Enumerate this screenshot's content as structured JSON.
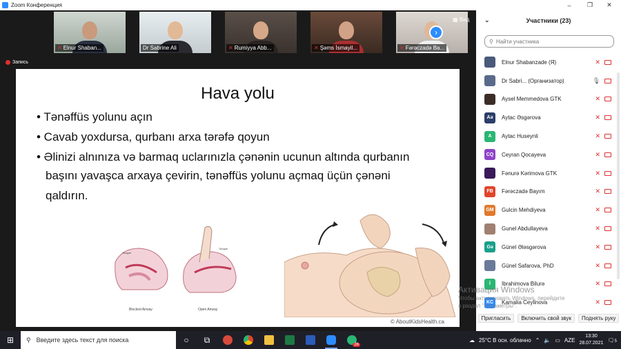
{
  "window": {
    "title": "Zoom Конференция",
    "controls": [
      "–",
      "❐",
      "✕"
    ]
  },
  "gallery": {
    "thumbnails": [
      {
        "name": "Elnur Shaban...",
        "muted": true,
        "active": false
      },
      {
        "name": "Dr Sabrine Ali",
        "muted": false,
        "active": true
      },
      {
        "name": "Rumiyya Abb...",
        "muted": true,
        "active": false
      },
      {
        "name": "Şəms İsmayil...",
        "muted": true,
        "active": false
      },
      {
        "name": "Fərəczadə Ba...",
        "muted": true,
        "active": false
      }
    ],
    "view_label": "Вид",
    "recording_label": "Запись"
  },
  "slide": {
    "title": "Hava yolu",
    "bullets": [
      "• Tənəffüs yolunu açın",
      "• Cavab yoxdursa, qurbanı arxa tərəfə qoyun",
      "• Əlinizi alnınıza və barmaq uclarınızla çənənin ucunun altında qurbanın",
      "başını yavaşca arxaya çevirin, tənəffüs yolunu açmaq üçün çənəni",
      "qaldırın."
    ],
    "left_illustration_labels": [
      "Tongue",
      "Tongue",
      "Blocked Airway",
      "Open Airway"
    ],
    "credit": "© AboutKidsHealth.ca"
  },
  "participants": {
    "header": "Участники (23)",
    "search_placeholder": "Найти участника",
    "list": [
      {
        "name": "Elnur Shabanzade (Я)",
        "initials": "",
        "color": "#4a5a7a",
        "mic": "off",
        "cam": "off"
      },
      {
        "name": "Dr Sabri... (Организатор)",
        "initials": "",
        "color": "#5a6a8a",
        "mic": "on",
        "cam": "off"
      },
      {
        "name": "Aysel Memmedova GTK",
        "initials": "",
        "color": "#3b2e28",
        "mic": "off",
        "cam": "off"
      },
      {
        "name": "Aytac Əsgərova",
        "initials": "Aə",
        "color": "#2c3e6a",
        "mic": "off",
        "cam": "off"
      },
      {
        "name": "Aytac Huseynli",
        "initials": "A",
        "color": "#2bb673",
        "mic": "off",
        "cam": "off"
      },
      {
        "name": "Ceyran Qocayeva",
        "initials": "CQ",
        "color": "#8e44c9",
        "mic": "off",
        "cam": "off"
      },
      {
        "name": "Fənurə Kərimova GTK",
        "initials": "",
        "color": "#3a1a5a",
        "mic": "off",
        "cam": "off"
      },
      {
        "name": "Fərəczadə Bayım",
        "initials": "FB",
        "color": "#e0452c",
        "mic": "off",
        "cam": "off"
      },
      {
        "name": "Gulcin Mehdiyeva",
        "initials": "GM",
        "color": "#e07a2c",
        "mic": "off",
        "cam": "off"
      },
      {
        "name": "Gunel Abdullayeva",
        "initials": "",
        "color": "#a08070",
        "mic": "off",
        "cam": "off"
      },
      {
        "name": "Günel Ələsgərova",
        "initials": "Gə",
        "color": "#1aa08a",
        "mic": "off",
        "cam": "off"
      },
      {
        "name": "Günel Safarova, PhD",
        "initials": "",
        "color": "#6a7a9a",
        "mic": "off",
        "cam": "off"
      },
      {
        "name": "Ibrahimova Bilurə",
        "initials": "İ",
        "color": "#2bb673",
        "mic": "off",
        "cam": "off"
      },
      {
        "name": "Kamalia Ceylinova",
        "initials": "KC",
        "color": "#2d8cff",
        "mic": "off",
        "cam": "off"
      }
    ],
    "footer_buttons": [
      "Пригласить",
      "Включить свой звук",
      "Поднять руку"
    ]
  },
  "activation": {
    "line1": "Активация Windows",
    "line2": "Чтобы активировать Windows, перейдите",
    "line3": "в раздел \"Параметры\"."
  },
  "taskbar": {
    "search_placeholder": "Введите здесь текст для поиска",
    "whatsapp_badge": "26",
    "weather": "25°C  В осн. облачно",
    "language": "AZE",
    "time": "13:30",
    "date": "28.07.2021",
    "notification_count": "5"
  },
  "colors": {
    "zoom_blue": "#2d8cff",
    "muted_red": "#e02f2f",
    "active_speaker": "#d9e44a"
  }
}
